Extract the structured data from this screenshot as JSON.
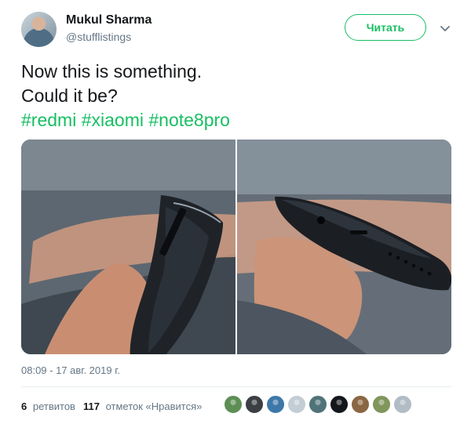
{
  "author": {
    "name": "Mukul Sharma",
    "handle": "@stufflistings"
  },
  "follow_button": {
    "label": "Читать"
  },
  "icons": {
    "caret": "chevron-down-icon",
    "avatar": "user-avatar"
  },
  "tweet": {
    "lines": [
      "Now this is something.",
      "Could it be?"
    ],
    "hashtags": [
      "#redmi",
      "#xiaomi",
      "#note8pro"
    ]
  },
  "timestamp": "08:09 - 17 авг. 2019 г.",
  "stats": {
    "retweets_count": "6",
    "retweets_label": "ретвитов",
    "likes_count": "117",
    "likes_label": "отметок «Нравится»"
  },
  "colors": {
    "accent": "#17bf63",
    "muted_text": "#657786",
    "main_text": "#14171a",
    "divider": "#e6ecf0"
  },
  "likers": [
    {
      "color": "#5d8f54"
    },
    {
      "color": "#3b3f44"
    },
    {
      "color": "#3d78a8"
    },
    {
      "color": "#c2cdd6"
    },
    {
      "color": "#4f7378"
    },
    {
      "color": "#13161b"
    },
    {
      "color": "#8a6642"
    },
    {
      "color": "#81965c"
    },
    {
      "color": "#b2bcc5"
    }
  ]
}
